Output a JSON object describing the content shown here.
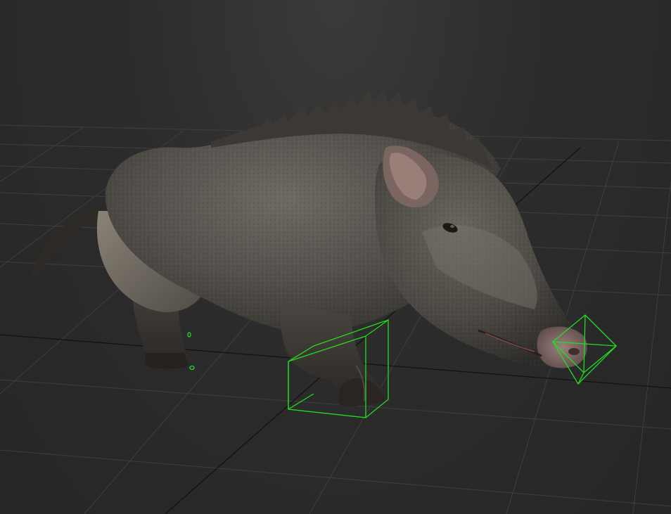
{
  "viewport": {
    "name": "3d-perspective-viewport",
    "background": "#2a2a2a",
    "grid_color": "#3f3f3f",
    "axis_color": "#101010",
    "selection_color": "#22dd22"
  },
  "model": {
    "name": "wild-boar",
    "fur_color": "#5a5651",
    "snout_color": "#8a6f6c"
  }
}
